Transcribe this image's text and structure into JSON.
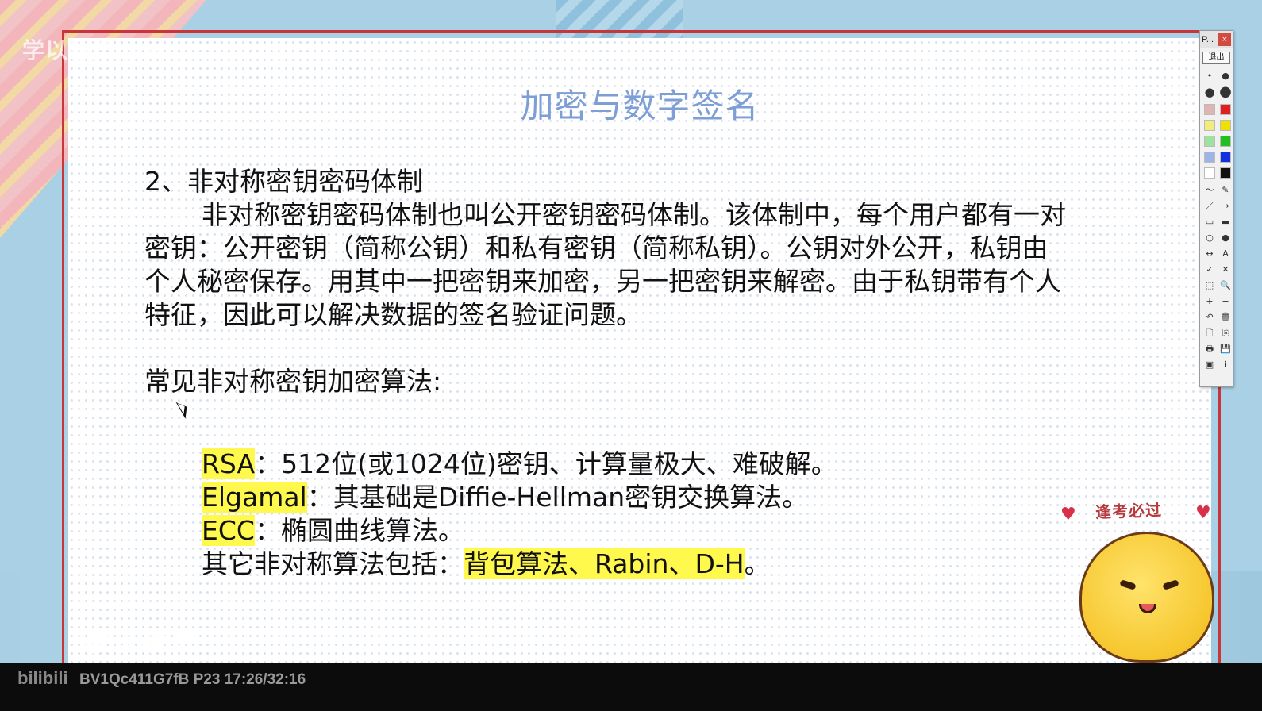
{
  "watermark": "学以致知Learning bilibili",
  "slide": {
    "title": "加密与数字签名",
    "section_heading": "2、非对称密钥密码体制",
    "paragraph_lines": [
      "非对称密钥密码体制也叫公开密钥密码体制。该体制中，每个用户都有一对",
      "密钥：公开密钥（简称公钥）和私有密钥（简称私钥）。公钥对外公开，私钥由",
      "个人秘密保存。用其中一把密钥来加密，另一把密钥来解密。由于私钥带有个人",
      "特征，因此可以解决数据的签名验证问题。"
    ],
    "algorithms_heading": "常见非对称密钥加密算法:",
    "algorithms": [
      {
        "name": "RSA",
        "desc": "：512位(或1024位)密钥、计算量极大、难破解。"
      },
      {
        "name": "Elgamal",
        "desc": "：其基础是Diffie-Hellman密钥交换算法。"
      },
      {
        "name": "ECC",
        "desc": "：椭圆曲线算法。"
      }
    ],
    "others_prefix": "其它非对称算法包括：",
    "others_highlight": "背包算法、Rabin、D-H",
    "others_suffix": "。"
  },
  "toolbar": {
    "title": "P...",
    "close_label": "×",
    "exit_label": "退出",
    "swatches": [
      "#e0b4b4",
      "#e02020",
      "#f4ec7a",
      "#f0e000",
      "#9de39d",
      "#20c020",
      "#9db4e8",
      "#1030e0",
      "#ffffff",
      "#111111"
    ],
    "tools": [
      "〜",
      "✎",
      "／",
      "→",
      "▭",
      "▬",
      "○",
      "●",
      "↔",
      "A",
      "✓",
      "✕",
      "⬚",
      "🔍",
      "+",
      "−",
      "↶",
      "🗑",
      "🗋",
      "⎘",
      "🖶",
      "💾",
      "▣",
      "ℹ"
    ]
  },
  "decor": {
    "sticker_text": "逢考必过",
    "script_logo": "学以致知"
  },
  "bottom_bar": {
    "logo": "bilibili",
    "video_info": "BV1Qc411G7fB P23 17:26/32:16"
  }
}
